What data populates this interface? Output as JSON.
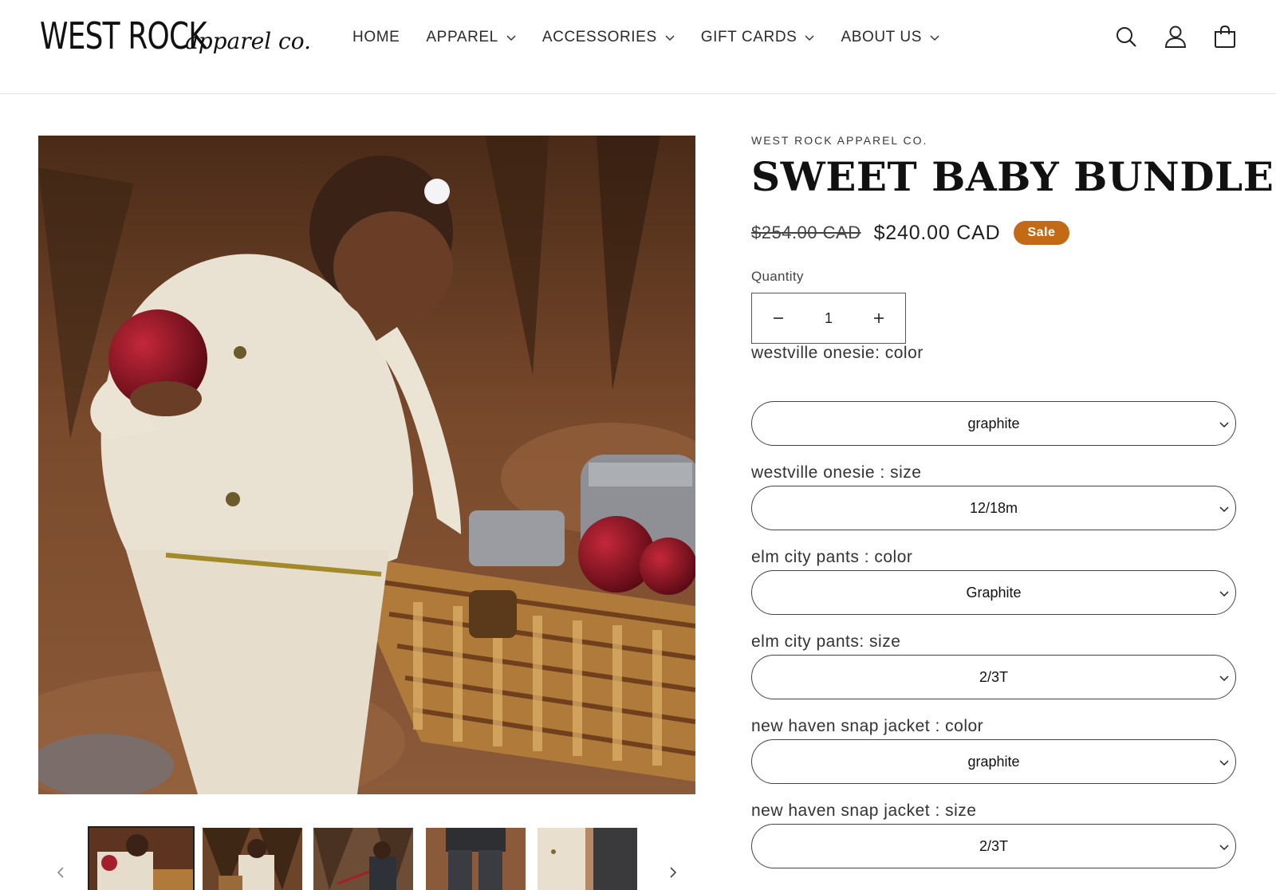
{
  "header": {
    "logo_main": "WEST ROCK",
    "logo_sub": "apparel co.",
    "nav": [
      {
        "label": "HOME",
        "has_dropdown": false
      },
      {
        "label": "APPAREL",
        "has_dropdown": true
      },
      {
        "label": "ACCESSORIES",
        "has_dropdown": true
      },
      {
        "label": "GIFT CARDS",
        "has_dropdown": true
      },
      {
        "label": "ABOUT US",
        "has_dropdown": true
      }
    ],
    "icons": [
      "search-icon",
      "account-icon",
      "cart-icon"
    ]
  },
  "gallery": {
    "main_image": "child-in-cream-outfit-with-apple-and-picnic-basket",
    "thumbnails": [
      "thumb-child-with-apple",
      "thumb-child-sitting-forest",
      "thumb-child-dark-outfit",
      "thumb-dark-pants",
      "thumb-cream-and-dark-outfits"
    ],
    "prev_icon": "chevron-left-icon",
    "next_icon": "chevron-right-icon"
  },
  "product": {
    "vendor": "WEST ROCK APPAREL CO.",
    "title": "SWEET BABY BUNDLE",
    "price_compare": "$254.00 CAD",
    "price_sale": "$240.00 CAD",
    "badge": "Sale",
    "quantity_label": "Quantity",
    "quantity_value": "1",
    "options": [
      {
        "label": "westville onesie: color",
        "value": "graphite"
      },
      {
        "label": "westville onesie : size",
        "value": "12/18m"
      },
      {
        "label": "elm city pants : color",
        "value": "Graphite"
      },
      {
        "label": "elm city pants: size",
        "value": "2/3T"
      },
      {
        "label": "new haven snap jacket : color",
        "value": "graphite"
      },
      {
        "label": "new haven snap jacket : size",
        "value": "2/3T"
      }
    ]
  },
  "colors": {
    "badge": "#c26a16",
    "text": "#1f1f1f"
  }
}
